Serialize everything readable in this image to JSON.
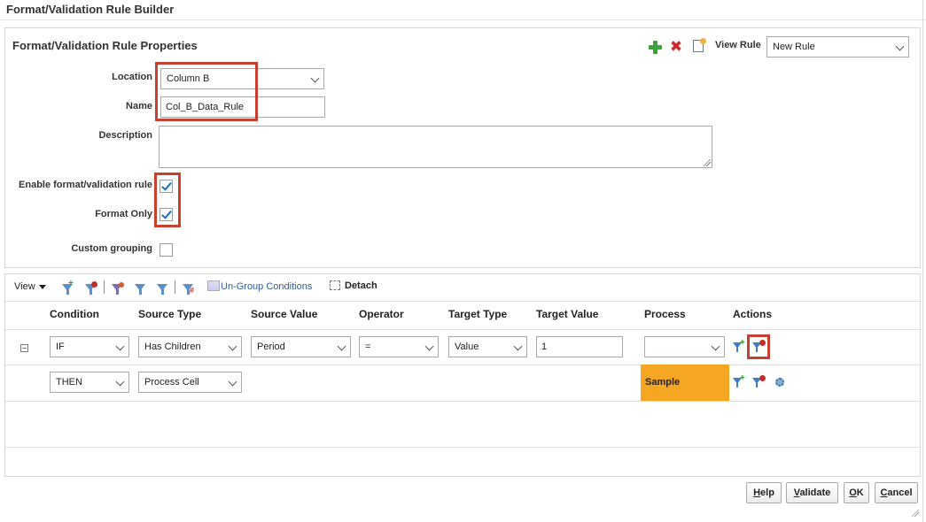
{
  "dialog": {
    "title": "Format/Validation Rule Builder"
  },
  "properties": {
    "title": "Format/Validation Rule Properties",
    "view_rule_label": "View Rule",
    "view_rule_value": "New Rule",
    "location_label": "Location",
    "location_value": "Column B",
    "name_label": "Name",
    "name_value": "Col_B_Data_Rule",
    "description_label": "Description",
    "description_value": "",
    "enable_label": "Enable format/validation rule",
    "enable_checked": true,
    "format_only_label": "Format Only",
    "format_only_checked": true,
    "custom_grouping_label": "Custom grouping",
    "custom_grouping_checked": false
  },
  "conditions": {
    "view_menu_label": "View",
    "ungroup_label": "Un-Group Conditions",
    "detach_label": "Detach",
    "columns": [
      "Condition",
      "Source Type",
      "Source Value",
      "Operator",
      "Target Type",
      "Target Value",
      "Process",
      "Actions"
    ],
    "rows": [
      {
        "condition": "IF",
        "source_type": "Has Children",
        "source_value": "Period",
        "operator": "=",
        "target_type": "Value",
        "target_value": "1",
        "process": ""
      },
      {
        "condition": "THEN",
        "source_type": "Process Cell",
        "process": "Sample"
      }
    ]
  },
  "buttons": {
    "help": {
      "mnemonic": "H",
      "rest": "elp"
    },
    "validate": {
      "mnemonic": "V",
      "rest": "alidate"
    },
    "ok": {
      "mnemonic": "O",
      "rest": "K"
    },
    "cancel": {
      "mnemonic": "C",
      "rest": "ancel"
    }
  },
  "colors": {
    "highlight": "#c8402f",
    "sample_cell": "#f5a623",
    "link": "#2a5db0"
  }
}
